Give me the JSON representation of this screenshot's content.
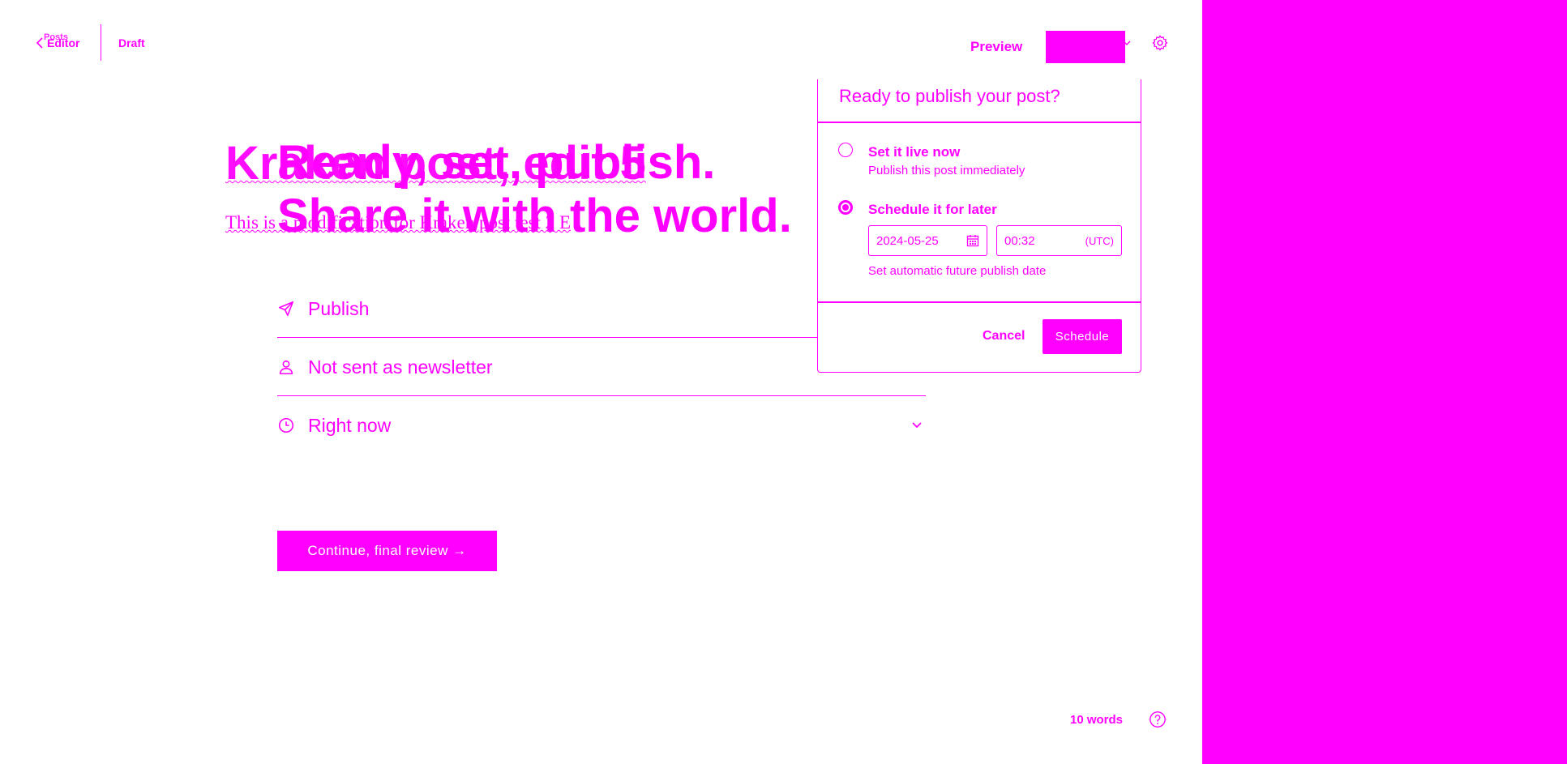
{
  "header": {
    "back_label": "Editor",
    "back_label_under": "Posts",
    "status": "Draft",
    "preview_label": "Preview",
    "settings_icon": "gear-icon"
  },
  "post": {
    "title": "Kraken post, edit 5",
    "excerpt": "This is a modification for Kraken post test 2 E"
  },
  "flow": {
    "headline_line1": "Ready, set, publish.",
    "headline_line2": "Share it with the world.",
    "options": [
      {
        "icon": "send-icon",
        "label": "Publish"
      },
      {
        "icon": "user-icon",
        "label": "Not sent as newsletter"
      },
      {
        "icon": "clock-icon",
        "label": "Right now"
      }
    ],
    "continue_label": "Continue, final review →"
  },
  "popup": {
    "title": "Ready to publish your post?",
    "option_now_title": "Set it live now",
    "option_now_desc": "Publish this post immediately",
    "option_later_title": "Schedule it for later",
    "date_value": "2024-05-25",
    "time_value": "00:32",
    "timezone": "(UTC)",
    "hint": "Set automatic future publish date",
    "selected_option": "later",
    "cancel_label": "Cancel",
    "schedule_label": "Schedule"
  },
  "footer": {
    "word_count": "10 words",
    "help_icon": "help-icon"
  },
  "colors": {
    "accent": "#ff00ff",
    "background": "#ffffff"
  }
}
